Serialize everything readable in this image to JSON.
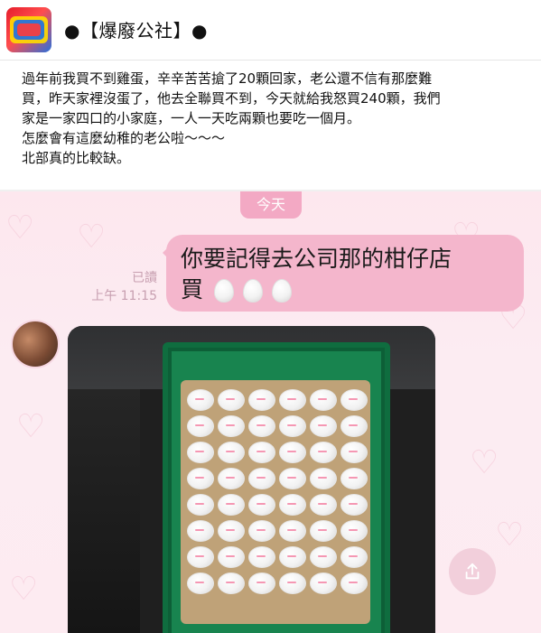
{
  "page": {
    "name": "●【爆廢公社】●",
    "avatar_label": "爆廢公社"
  },
  "post": {
    "lines": [
      "過年前我買不到雞蛋，辛辛苦苦搶了20顆回家，老公還不信有那麼難",
      "買，昨天家裡沒蛋了，他去全聯買不到，今天就給我怒買240顆，我們",
      "家是一家四口的小家庭，一人一天吃兩顆也要吃一個月。",
      "怎麼會有這麼幼稚的老公啦～～～",
      "北部真的比較缺。"
    ]
  },
  "chat": {
    "date_label": "今天",
    "read_label": "已讀",
    "time_label": "上午 11:15",
    "message_line1": "你要記得去公司那的柑仔店",
    "message_line2": "買"
  },
  "icons": {
    "share": "share-icon",
    "heart": "heart-icon",
    "egg": "egg-icon"
  },
  "colors": {
    "bubble": "#f4b6cc",
    "date_pill": "#f3a9c4",
    "chat_bg": "#fde7ee",
    "crate": "#18844f"
  }
}
